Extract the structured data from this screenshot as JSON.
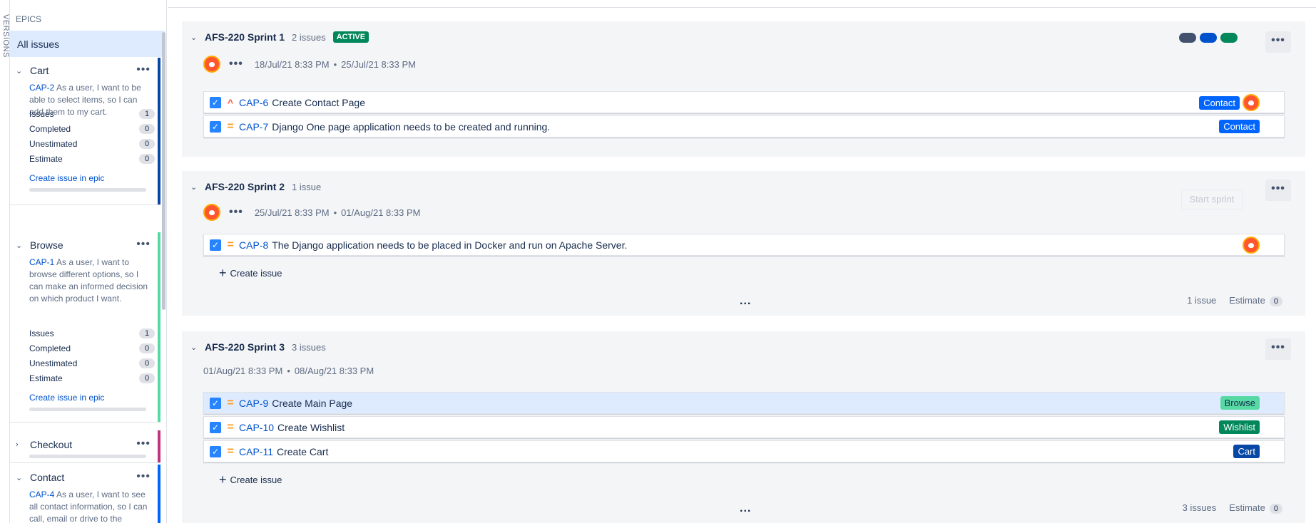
{
  "rail": {
    "versions_label": "VERSIONS"
  },
  "epics": {
    "header": "EPICS",
    "all_issues": "All issues",
    "items": [
      {
        "name": "Cart",
        "key": "CAP-2",
        "desc": "As a user, I want to be able to select items, so I can add them to my cart.",
        "issues_label": "Issues",
        "issues": "1",
        "completed_label": "Completed",
        "completed": "0",
        "unestimated_label": "Unestimated",
        "unestimated": "0",
        "estimate_label": "Estimate",
        "estimate": "0",
        "create": "Create issue in epic",
        "color": "#0747a6"
      },
      {
        "name": "Browse",
        "key": "CAP-1",
        "desc": "As a user, I want to browse different options, so I can make an informed decision on which product I want.",
        "issues_label": "Issues",
        "issues": "1",
        "completed_label": "Completed",
        "completed": "0",
        "unestimated_label": "Unestimated",
        "unestimated": "0",
        "estimate_label": "Estimate",
        "estimate": "0",
        "create": "Create issue in epic",
        "color": "#57d9a3"
      },
      {
        "name": "Checkout",
        "color": "#c0347f"
      },
      {
        "name": "Contact",
        "key": "CAP-4",
        "desc": "As a user, I want to see all contact information, so I can call, email or drive to the",
        "color": "#0065ff"
      }
    ]
  },
  "sprints": [
    {
      "name": "AFS-220 Sprint 1",
      "count": "2 issues",
      "status": "ACTIVE",
      "start": "18/Jul/21 8:33 PM",
      "end": "25/Jul/21 8:33 PM",
      "sep": "•",
      "status_colors": [
        "#42526e",
        "#0052cc",
        "#00875a"
      ],
      "issues": [
        {
          "key": "CAP-6",
          "summary": "Create Contact Page",
          "priority": "high",
          "epic": "Contact",
          "epic_color": "#0065ff"
        },
        {
          "key": "CAP-7",
          "summary": "Django One page application needs to be created and running.",
          "priority": "medium",
          "epic": "Contact",
          "epic_color": "#0065ff"
        }
      ]
    },
    {
      "name": "AFS-220 Sprint 2",
      "count": "1 issue",
      "start_button": "Start sprint",
      "start": "25/Jul/21 8:33 PM",
      "end": "01/Aug/21 8:33 PM",
      "sep": "•",
      "issues": [
        {
          "key": "CAP-8",
          "summary": "The Django application needs to be placed in Docker and run on Apache Server.",
          "priority": "medium"
        }
      ],
      "create": "Create issue",
      "footer_count": "1 issue",
      "estimate_label": "Estimate",
      "estimate": "0"
    },
    {
      "name": "AFS-220 Sprint 3",
      "count": "3 issues",
      "start": "01/Aug/21 8:33 PM",
      "end": "08/Aug/21 8:33 PM",
      "sep": "•",
      "issues": [
        {
          "key": "CAP-9",
          "summary": "Create Main Page",
          "priority": "medium",
          "epic": "Browse",
          "epic_color": "#57d9a3"
        },
        {
          "key": "CAP-10",
          "summary": "Create Wishlist",
          "priority": "medium",
          "epic": "Wishlist",
          "epic_color": "#00875a"
        },
        {
          "key": "CAP-11",
          "summary": "Create Cart",
          "priority": "medium",
          "epic": "Cart",
          "epic_color": "#0747a6"
        }
      ],
      "create": "Create issue",
      "footer_count": "3 issues",
      "estimate_label": "Estimate",
      "estimate": "0"
    }
  ],
  "icons": {
    "more": "•••",
    "dots": "...",
    "chevron_down": "⌄",
    "chevron_right": "›",
    "check": "✓",
    "plus": "+",
    "prio_high": "^",
    "prio_medium": "="
  }
}
